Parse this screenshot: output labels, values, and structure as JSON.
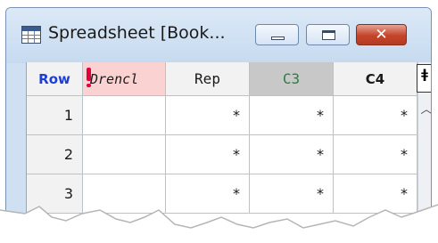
{
  "window": {
    "title": "Spreadsheet [Book...",
    "icon": "spreadsheet-icon",
    "controls": {
      "minimize": "minimize-icon",
      "maximize": "maximize-icon",
      "close_label": "✕"
    }
  },
  "grid": {
    "row_header": "Row",
    "columns": [
      "Drencl",
      "Rep",
      "C3",
      "C4"
    ],
    "rows": [
      {
        "num": "1",
        "cells": [
          "",
          "*",
          "*",
          "*"
        ]
      },
      {
        "num": "2",
        "cells": [
          "",
          "*",
          "*",
          "*"
        ]
      },
      {
        "num": "3",
        "cells": [
          "",
          "*",
          "*",
          "*"
        ]
      }
    ],
    "scroll_top_icon": "freeze-pin-icon",
    "scroll_up_icon": "chevron-up-icon"
  },
  "colors": {
    "title_bg": "#cfe0f2",
    "row_header_text": "#1e3fd6",
    "selected_column_header": "#fbd2d2",
    "close_button": "#c4442a"
  }
}
